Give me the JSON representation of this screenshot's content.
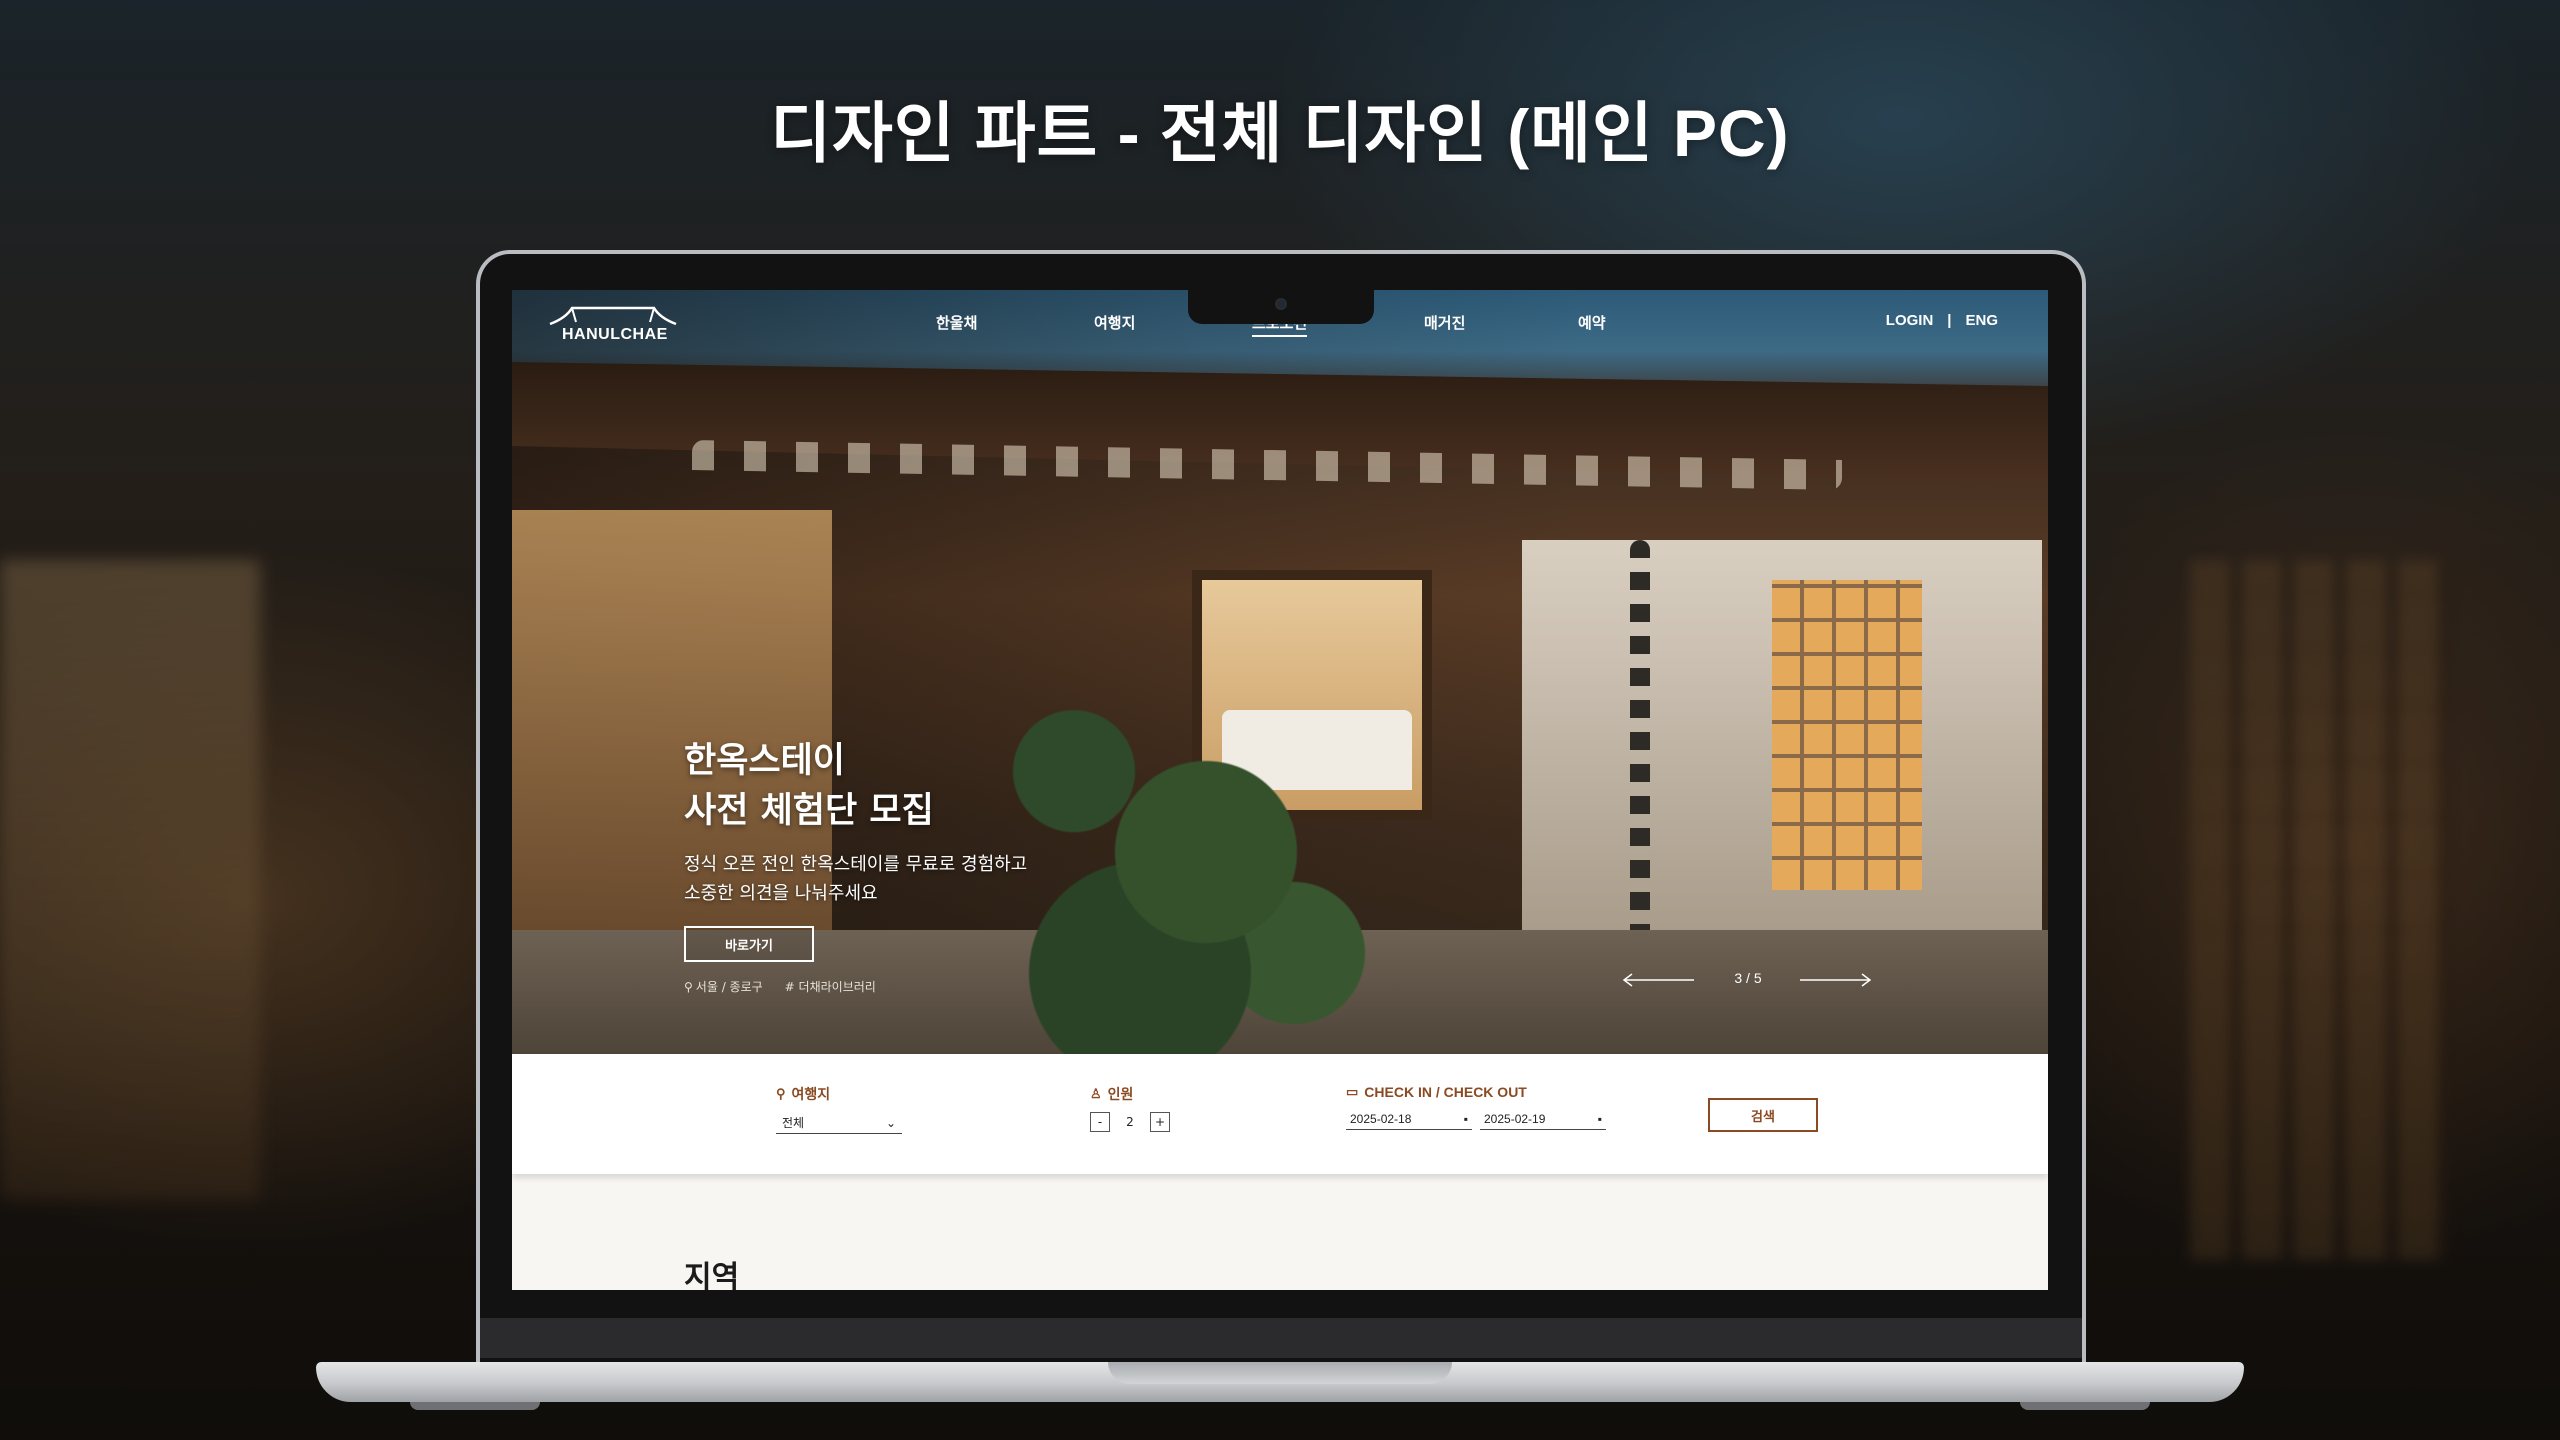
{
  "slide": {
    "title": "디자인 파트 - 전체 디자인 (메인 PC)"
  },
  "nav": {
    "logo_text": "HANULCHAE",
    "items": [
      {
        "label": "한울채",
        "active": false
      },
      {
        "label": "여행지",
        "active": false
      },
      {
        "label": "프로모션",
        "active": true
      },
      {
        "label": "매거진",
        "active": false
      },
      {
        "label": "예약",
        "active": false
      }
    ],
    "login": "LOGIN",
    "divider": "|",
    "lang": "ENG"
  },
  "hero": {
    "title_line1": "한옥스테이",
    "title_line2": "사전 체험단 모집",
    "sub_line1": "정식 오픈 전인 한옥스테이를 무료로 경험하고",
    "sub_line2": "소중한 의견을 나눠주세요",
    "button": "바로가기",
    "location": "서울 / 종로구",
    "tag": "# 더채라이브러리",
    "slide_count": "3 / 5"
  },
  "search": {
    "destination_label": "여행지",
    "destination_value": "전체",
    "guests_label": "인원",
    "guests_minus": "-",
    "guests_value": "2",
    "guests_plus": "+",
    "dates_label": "CHECK IN / CHECK OUT",
    "checkin": "2025-02-18",
    "checkout": "2025-02-19",
    "button": "검색"
  },
  "region": {
    "title": "지역"
  },
  "colors": {
    "accent": "#8a4a22",
    "hero_text": "#ffffff",
    "page_bg": "#f8f6f2"
  },
  "icons": [
    "pin-icon",
    "person-icon",
    "calendar-icon",
    "arrow-left-icon",
    "arrow-right-icon",
    "chevron-down-icon"
  ]
}
